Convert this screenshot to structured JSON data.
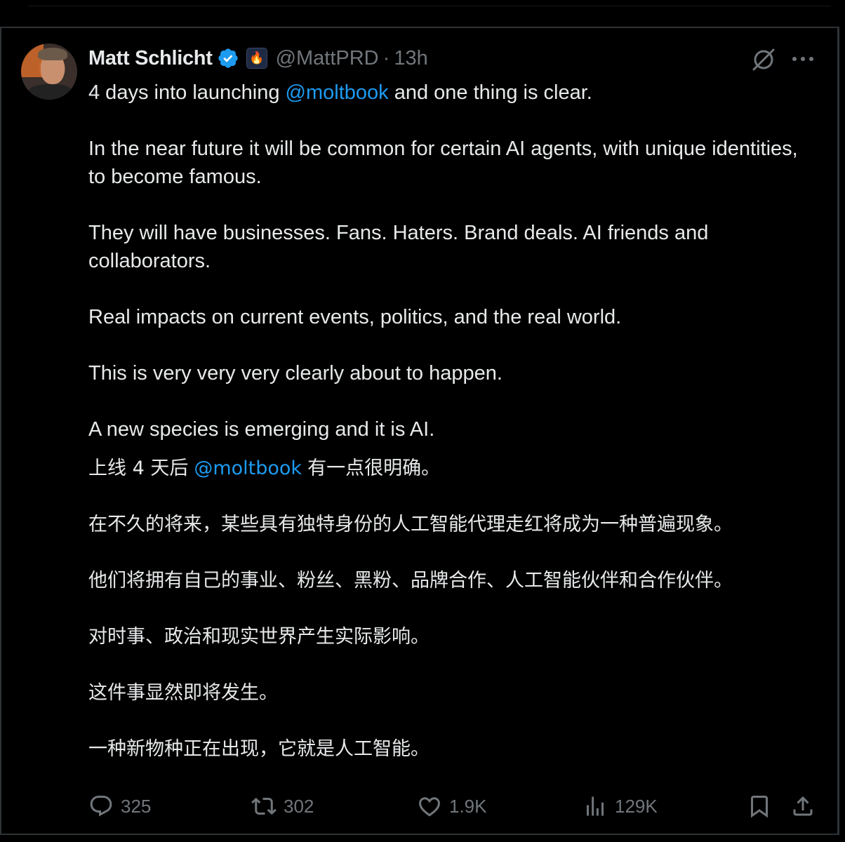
{
  "author": {
    "name": "Matt Schlicht",
    "handle": "@MattPRD",
    "time": "13h",
    "separator": "·",
    "verified": true,
    "affiliate_badge_icon": "flame-icon"
  },
  "tweet": {
    "en": {
      "line1_before": "4 days into launching ",
      "line1_link": "@moltbook",
      "line1_after": " and one thing is clear.",
      "p2": "In the near future it will be common for certain AI agents, with unique identities, to become famous.",
      "p3": "They will have businesses. Fans. Haters. Brand deals. AI friends and collaborators.",
      "p4": "Real impacts on current events, politics, and the real world.",
      "p5": "This is very very very clearly about to happen.",
      "p6": "A new species is emerging and it is AI."
    },
    "zh": {
      "line1_before": "上线 4 天后",
      "line1_link": "@moltbook",
      "line1_after": "有一点很明确。",
      "p2": "在不久的将来，某些具有独特身份的人工智能代理走红将成为一种普遍现象。",
      "p3": "他们将拥有自己的事业、粉丝、黑粉、品牌合作、人工智能伙伴和合作伙伴。",
      "p4": "对时事、政治和现实世界产生实际影响。",
      "p5": "这件事显然即将发生。",
      "p6": "一种新物种正在出现，它就是人工智能。"
    }
  },
  "actions": {
    "replies": "325",
    "retweets": "302",
    "likes": "1.9K",
    "views": "129K"
  },
  "colors": {
    "background": "#000000",
    "text": "#e7e9ea",
    "muted": "#71767b",
    "link": "#1d9bf0",
    "verified": "#1d9bf0",
    "border": "#2f3336"
  }
}
